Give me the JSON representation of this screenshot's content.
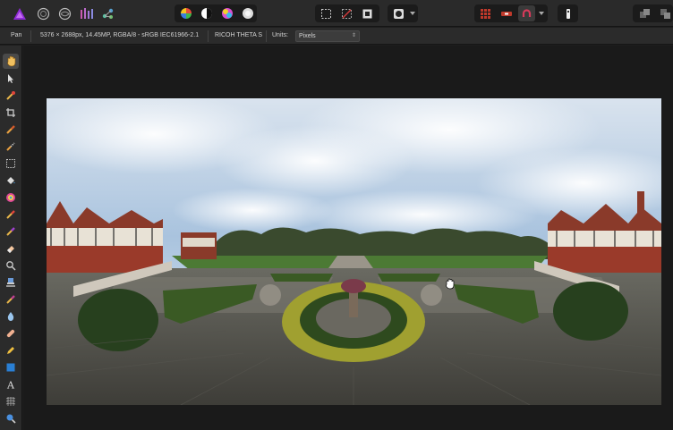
{
  "context_bar": {
    "tool_name": "Pan",
    "document_info": "5376 × 2688px, 14.45MP, RGBA/8 - sRGB IEC61966-2.1",
    "camera": "RICOH THETA S",
    "units_label": "Units:",
    "units_value": "Pixels"
  },
  "toolbar": {
    "icons": [
      "affinity-photo-logo-icon",
      "develop-persona-icon",
      "liquify-persona-icon",
      "tone-mapping-persona-icon",
      "export-persona-icon",
      "color-wheel-icon",
      "contrast-icon",
      "hsl-icon",
      "white-balance-icon",
      "marquee-select-icon",
      "no-selection-icon",
      "invert-selection-icon",
      "mask-icon",
      "dropdown-arrow-icon",
      "snapping-grid-icon",
      "snapping-toggle-icon",
      "snapping-magnet-icon",
      "dropdown-arrow-icon",
      "assistant-icon",
      "arrange-icon"
    ]
  },
  "tools": [
    "pan-tool-icon",
    "move-tool-icon",
    "color-picker-tool-icon",
    "crop-tool-icon",
    "selection-brush-tool-icon",
    "flood-select-tool-icon",
    "marquee-tool-icon",
    "flood-fill-tool-icon",
    "gradient-tool-icon",
    "paint-brush-tool-icon",
    "color-replacement-tool-icon",
    "erase-brush-tool-icon",
    "dodge-tool-icon",
    "clone-tool-icon",
    "retouch-tool-icon",
    "blur-tool-icon",
    "healing-brush-tool-icon",
    "pen-tool-icon",
    "shape-tool-icon",
    "text-tool-icon",
    "mesh-warp-tool-icon",
    "zoom-tool-icon"
  ],
  "colors": {
    "app_bg": "#1e1e1e",
    "toolbar_bg": "#2a2a2a",
    "canvas_bg": "#1a1a1a",
    "accent_purple": "#7b2cbf",
    "snap_red": "#c0392b"
  }
}
